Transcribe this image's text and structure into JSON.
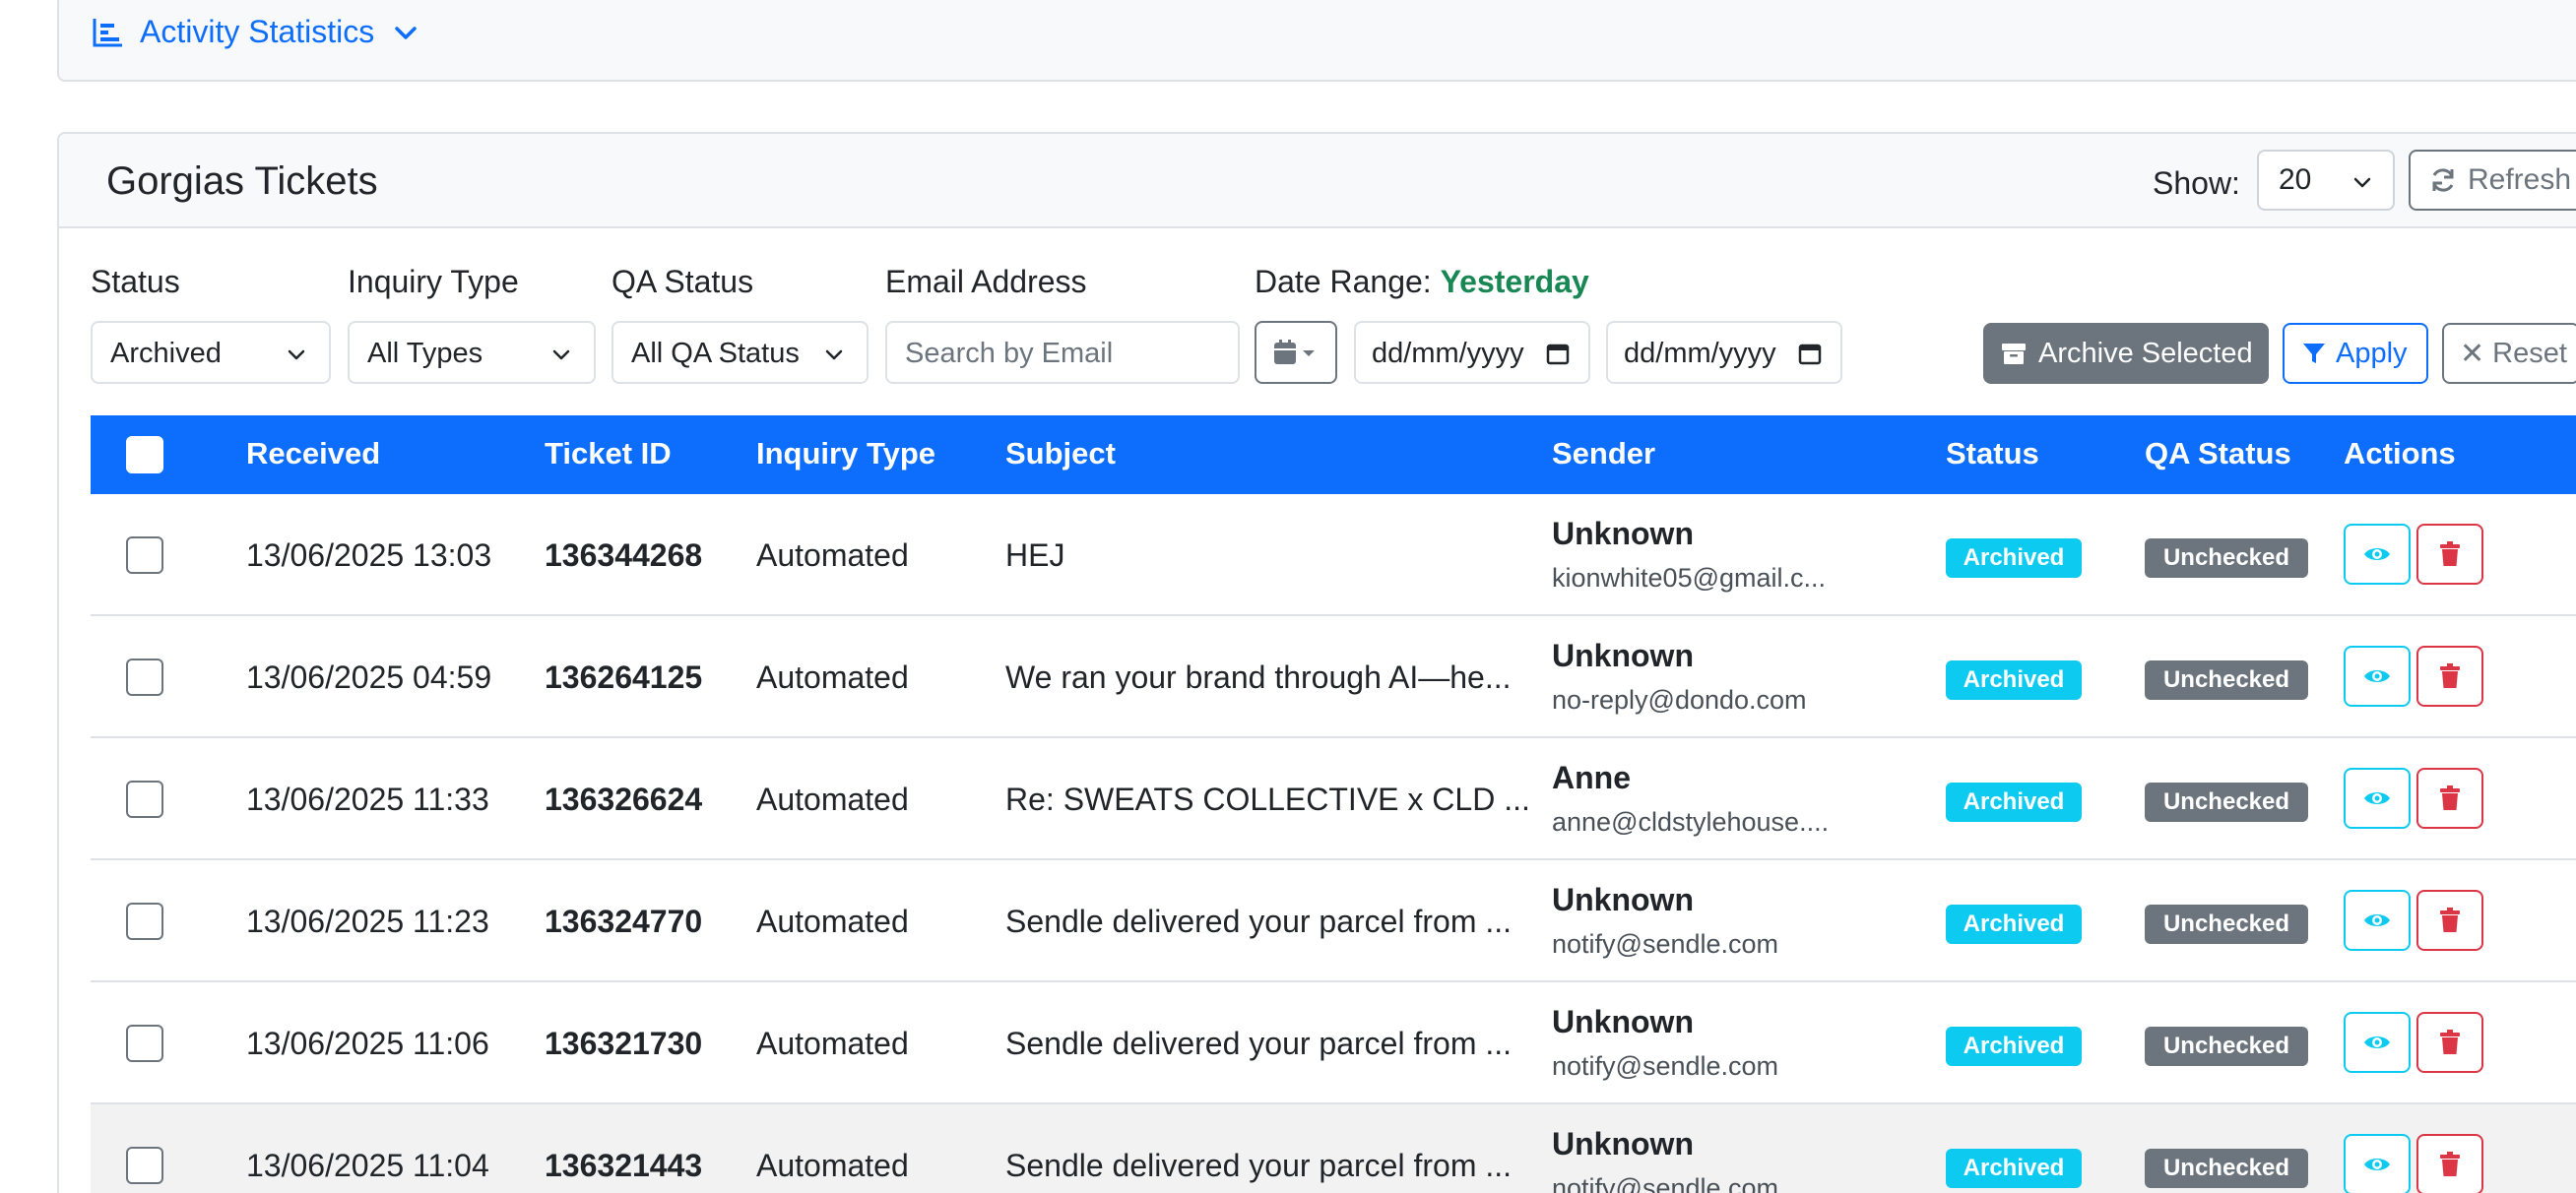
{
  "stats_panel": {
    "label": "Activity Statistics"
  },
  "card": {
    "title": "Gorgias Tickets",
    "show_label": "Show:",
    "show_value": "20",
    "refresh_label": "Refresh"
  },
  "filters": {
    "status_label": "Status",
    "status_value": "Archived",
    "inquiry_label": "Inquiry Type",
    "inquiry_value": "All Types",
    "qa_label": "QA Status",
    "qa_value": "All QA Status",
    "email_label": "Email Address",
    "email_placeholder": "Search by Email",
    "date_range_label": "Date Range:",
    "date_range_value": "Yesterday",
    "date_from": "dd/mm/yyyy",
    "date_to": "dd/mm/yyyy",
    "archive_selected_label": "Archive Selected",
    "apply_label": "Apply",
    "reset_label": "Reset"
  },
  "table": {
    "headers": [
      "Received",
      "Ticket ID",
      "Inquiry Type",
      "Subject",
      "Sender",
      "Status",
      "QA Status",
      "Actions"
    ],
    "rows": [
      {
        "received": "13/06/2025 13:03",
        "ticket_id": "136344268",
        "inquiry": "Automated",
        "subject": "HEJ",
        "sender_name": "Unknown",
        "sender_email": "kionwhite05@gmail.c...",
        "status": "Archived",
        "qa": "Unchecked"
      },
      {
        "received": "13/06/2025 04:59",
        "ticket_id": "136264125",
        "inquiry": "Automated",
        "subject": "We ran your brand through AI—he...",
        "sender_name": "Unknown",
        "sender_email": "no-reply@dondo.com",
        "status": "Archived",
        "qa": "Unchecked"
      },
      {
        "received": "13/06/2025 11:33",
        "ticket_id": "136326624",
        "inquiry": "Automated",
        "subject": "Re: SWEATS COLLECTIVE x CLD ...",
        "sender_name": "Anne",
        "sender_email": "anne@cldstylehouse....",
        "status": "Archived",
        "qa": "Unchecked"
      },
      {
        "received": "13/06/2025 11:23",
        "ticket_id": "136324770",
        "inquiry": "Automated",
        "subject": "Sendle delivered your parcel from ...",
        "sender_name": "Unknown",
        "sender_email": "notify@sendle.com",
        "status": "Archived",
        "qa": "Unchecked"
      },
      {
        "received": "13/06/2025 11:06",
        "ticket_id": "136321730",
        "inquiry": "Automated",
        "subject": "Sendle delivered your parcel from ...",
        "sender_name": "Unknown",
        "sender_email": "notify@sendle.com",
        "status": "Archived",
        "qa": "Unchecked"
      },
      {
        "received": "13/06/2025 11:04",
        "ticket_id": "136321443",
        "inquiry": "Automated",
        "subject": "Sendle delivered your parcel from ...",
        "sender_name": "Unknown",
        "sender_email": "notify@sendle.com",
        "status": "Archived",
        "qa": "Unchecked"
      }
    ]
  },
  "colors": {
    "primary": "#0d6efd",
    "info": "#0dcaf0",
    "secondary": "#6c757d",
    "danger": "#dc3545",
    "success": "#198754"
  },
  "icons": {
    "stats": "bar-chart-icon",
    "refresh": "refresh-icon",
    "calendar": "calendar-icon",
    "archive": "archive-box-icon",
    "apply": "filter-icon",
    "reset": "close-icon",
    "view": "eye-icon",
    "delete": "trash-icon"
  }
}
